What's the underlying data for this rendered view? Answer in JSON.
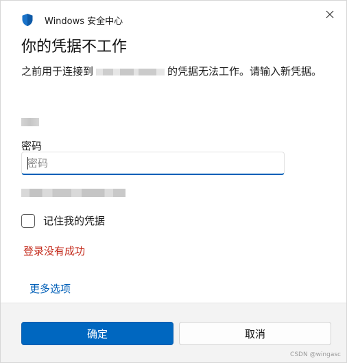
{
  "window": {
    "app_title": "Windows 安全中心",
    "close_glyph": "✕"
  },
  "dialog": {
    "heading": "你的凭据不工作",
    "description_prefix": "之前用于连接到",
    "description_suffix": "的凭据无法工作。请输入新凭据。"
  },
  "password": {
    "label": "密码",
    "placeholder": "密码",
    "value": ""
  },
  "remember": {
    "label": "记住我的凭据",
    "checked": false
  },
  "error_message": "登录没有成功",
  "more_options": "更多选项",
  "buttons": {
    "ok_label": "确定",
    "cancel_label": "取消"
  },
  "watermark": "CSDN @wingasc",
  "colors": {
    "accent": "#0067c0",
    "error": "#c42b1c",
    "link": "#005fb8",
    "shield": "#1a73c9"
  }
}
